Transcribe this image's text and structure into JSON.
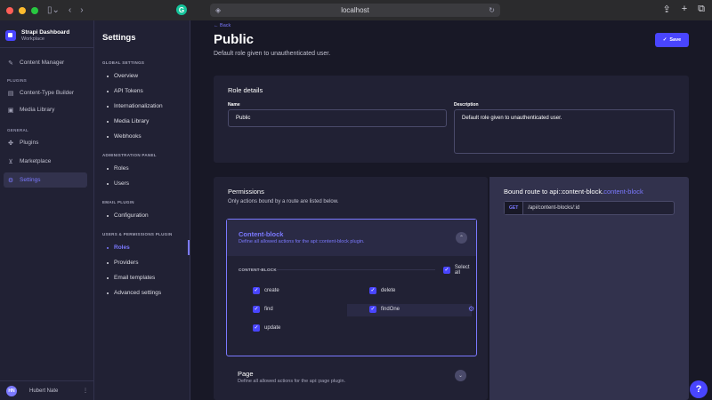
{
  "browser": {
    "url": "localhost"
  },
  "brand": {
    "title": "Strapi Dashboard",
    "subtitle": "Workplace"
  },
  "mainnav": {
    "content_manager": "Content Manager",
    "plugins_section": "PLUGINS",
    "content_type_builder": "Content-Type Builder",
    "media_library": "Media Library",
    "general_section": "GENERAL",
    "plugins": "Plugins",
    "marketplace": "Marketplace",
    "settings": "Settings"
  },
  "user": {
    "initials": "HN",
    "name": "Hubert Nate"
  },
  "subnav": {
    "title": "Settings",
    "sections": [
      {
        "label": "GLOBAL SETTINGS",
        "items": [
          "Overview",
          "API Tokens",
          "Internationalization",
          "Media Library",
          "Webhooks"
        ]
      },
      {
        "label": "ADMINISTRATION PANEL",
        "items": [
          "Roles",
          "Users"
        ]
      },
      {
        "label": "EMAIL PLUGIN",
        "items": [
          "Configuration"
        ]
      },
      {
        "label": "USERS & PERMISSIONS PLUGIN",
        "items": [
          "Roles",
          "Providers",
          "Email templates",
          "Advanced settings"
        ]
      }
    ]
  },
  "header": {
    "back": "Back",
    "title": "Public",
    "subtitle": "Default role given to unauthenticated user.",
    "save": "Save"
  },
  "role_details": {
    "title": "Role details",
    "name_label": "Name",
    "name_value": "Public",
    "description_label": "Description",
    "description_value": "Default role given to unauthenticated user."
  },
  "permissions": {
    "title": "Permissions",
    "subtitle": "Only actions bound by a route are listed below.",
    "content_block": {
      "title": "Content-block",
      "description": "Define all allowed actions for the api::content-block plugin.",
      "section_label": "CONTENT-BLOCK",
      "select_all": "Select all",
      "actions": [
        "create",
        "delete",
        "find",
        "findOne",
        "update"
      ]
    },
    "page": {
      "title": "Page",
      "description": "Define all allowed actions for the api::page plugin."
    }
  },
  "bound_route": {
    "title_prefix": "Bound route to",
    "title_api": "api::content-block",
    "title_dot": ".",
    "title_action": "content-block",
    "method": "GET",
    "path": "/api/content-blocks/:id"
  },
  "colors": {
    "accent": "#4945ff",
    "accent_text": "#7b79ff",
    "bg": "#181826",
    "panel": "#212134"
  }
}
